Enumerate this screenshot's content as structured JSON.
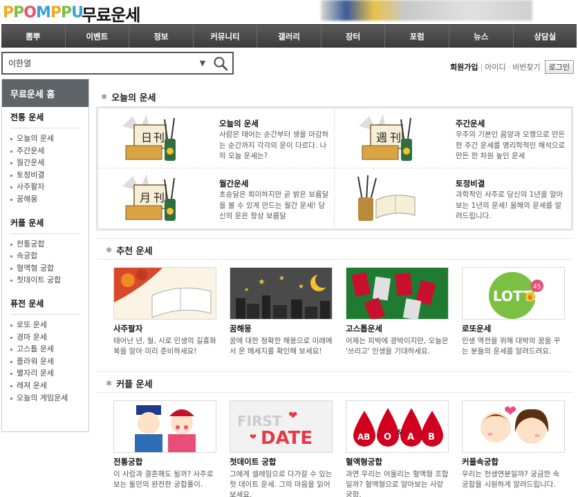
{
  "header": {
    "logo": [
      "P",
      "P",
      "O",
      "M",
      "P",
      "P",
      "U"
    ],
    "site_title": "무료운세"
  },
  "nav": [
    "뽐뿌",
    "이벤트",
    "정보",
    "커뮤니티",
    "갤러리",
    "장터",
    "포럼",
    "뉴스",
    "상담실"
  ],
  "search": {
    "value": "이한열"
  },
  "userlinks": {
    "join": "회원가입",
    "id": "아이디",
    "pw": "비번찾기",
    "login": "로그인"
  },
  "sidebar": {
    "home": "무료운세 홈",
    "groups": [
      {
        "title": "전통 운세",
        "items": [
          "오늘의 운세",
          "주간운세",
          "월간운세",
          "토정비결",
          "사주팔자",
          "꿈해몽"
        ]
      },
      {
        "title": "커플 운세",
        "items": [
          "전통궁합",
          "속궁합",
          "혈액형 궁합",
          "첫데이트 궁합"
        ]
      },
      {
        "title": "퓨전 운세",
        "items": [
          "로또 운세",
          "경마 운세",
          "고스톱 운세",
          "플라워 운세",
          "별자리 운세",
          "레져 운세",
          "오늘의 게임운세"
        ]
      }
    ]
  },
  "sections": {
    "today": "오늘의 운세",
    "recommend": "추천 운세",
    "couple": "커플 운세"
  },
  "today_items": [
    {
      "name": "오늘의 운세",
      "desc": "사람은 태어는 순간부터 생을 마감하는 순간까지 각각의 운이 다르다. 나의 오늘 운세는?"
    },
    {
      "name": "주간운세",
      "desc": "우주의 기본인 음양과 오행으로 만든 한 주간 운세를 명리학적인 해석으로 만든 한 차원 높인 운세"
    },
    {
      "name": "월간운세",
      "desc": "초승달은 희미하지만 곧 밝은 보름달을 볼 수 있게 만드는 월간 운세! 당신의 운은 항상 보름달"
    },
    {
      "name": "토정비결",
      "desc": "과학적인 사주로 당신의 1년을 알아보는 1년의 운세! 올해의 운세를 알려드립니다."
    }
  ],
  "today_chars": [
    "日",
    "刊",
    "週",
    "刊",
    "月",
    "刊"
  ],
  "recommend_items": [
    {
      "name": "사주팔자",
      "desc": "태어난 년, 월, 시로 인생의 길흉화복을 알아 미리 준비하세요!"
    },
    {
      "name": "꿈해몽",
      "desc": "꿈에 대한 정확한 해몽으로 미래에서 온 메세지를 확인해 보세요!"
    },
    {
      "name": "고스톱운세",
      "desc": "어제는 피박에 광박이지만, 오늘은 '쓰리고' 인생을 기대하세요."
    },
    {
      "name": "로또운세",
      "desc": "인생 역전을 위해 대박의 꿈을 꾸는 분들의 운세를 알려드려요."
    }
  ],
  "lotto_text": "LOTTO",
  "lotto_nums": [
    "45",
    "6"
  ],
  "couple_items": [
    {
      "name": "전통궁합",
      "desc": "이 사람과 결혼해도 될까? 사주로 보는 둘만의 완전한 궁합풀이."
    },
    {
      "name": "첫데이트 궁합",
      "desc": "그에게 셀레임으로 다가갈 수 있는 첫 데이트 운세. 그의 마음을 읽어보세요."
    },
    {
      "name": "혈액형궁합",
      "desc": "과연 우리는 어울리는 혈액형 조합일까? 혈액형으로 알아보는 사랑 궁합."
    },
    {
      "name": "커플속궁합",
      "desc": "우리는 천생연분일까? 궁금한 속궁합을 시원하게 알려드립니다."
    }
  ],
  "firstdate": {
    "line1": "FIRST",
    "line2": "DATE"
  },
  "blood_types": [
    "AB",
    "O",
    "A",
    "B"
  ],
  "blood_amp": "&"
}
